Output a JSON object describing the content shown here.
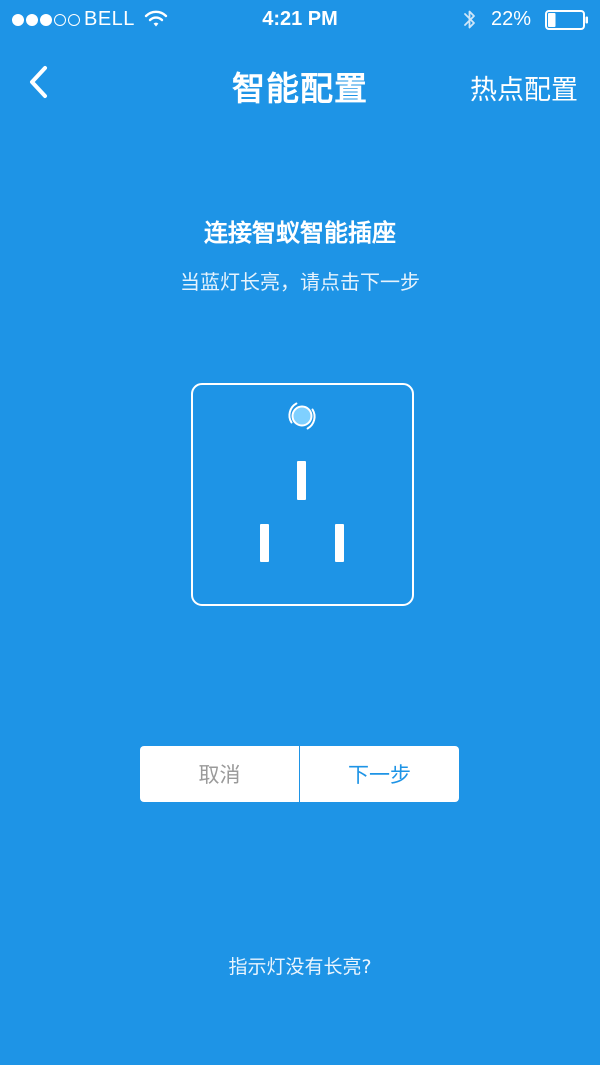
{
  "status_bar": {
    "signal_filled": 3,
    "signal_total": 5,
    "carrier": "BELL",
    "time": "4:21 PM",
    "battery_percent": "22%",
    "battery_level": 0.22,
    "icons": [
      "wifi-icon",
      "bluetooth-icon",
      "battery-icon"
    ]
  },
  "nav": {
    "back_icon": "chevron-left-icon",
    "title": "智能配置",
    "right_action": "热点配置"
  },
  "content": {
    "headline": "连接智蚁智能插座",
    "subtitle": "当蓝灯长亮，请点击下一步",
    "illustration": "power-socket-icon",
    "indicator_color": "#7fd0ff"
  },
  "buttons": {
    "cancel_label": "取消",
    "next_label": "下一步"
  },
  "help": {
    "link_label": "指示灯没有长亮?"
  },
  "colors": {
    "background": "#1e94e6",
    "button_background": "#ffffff",
    "cancel_text": "#9a9a9a",
    "next_text": "#1e94e6"
  }
}
